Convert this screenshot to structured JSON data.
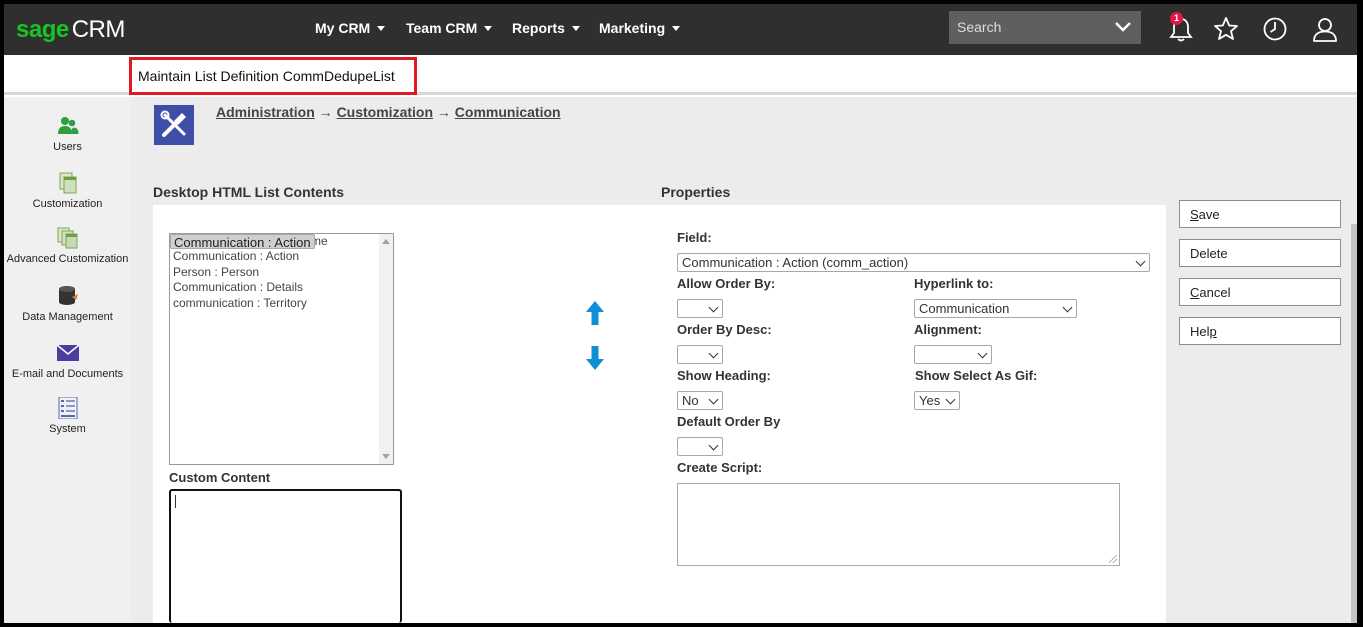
{
  "app": {
    "logo_brand": "sage",
    "logo_product": "CRM"
  },
  "nav": [
    {
      "label": "My CRM"
    },
    {
      "label": "Team CRM"
    },
    {
      "label": "Reports"
    },
    {
      "label": "Marketing"
    }
  ],
  "search": {
    "placeholder": "Search"
  },
  "notifications": {
    "count": "1"
  },
  "page_title": "Maintain List Definition CommDedupeList",
  "sidebar": {
    "items": [
      {
        "label": "Users",
        "icon": "users-icon"
      },
      {
        "label": "Customization",
        "icon": "customization-icon"
      },
      {
        "label": "Advanced Customization",
        "icon": "advanced-customization-icon"
      },
      {
        "label": "Data Management",
        "icon": "data-management-icon"
      },
      {
        "label": "E-mail and Documents",
        "icon": "email-icon"
      },
      {
        "label": "System",
        "icon": "system-icon"
      }
    ]
  },
  "breadcrumb": {
    "items": [
      "Administration",
      "Customization",
      "Communication"
    ],
    "separator": "→"
  },
  "list_section": {
    "title": "Desktop HTML List Contents",
    "items": [
      "Communication : Action",
      "Communication : Date / Time",
      "Communication : Action",
      "Person : Person",
      "Communication : Details",
      "communication : Territory"
    ],
    "selected_index": 0,
    "custom_content_label": "Custom Content"
  },
  "properties": {
    "title": "Properties",
    "field_label": "Field:",
    "field_value": "Communication : Action (comm_action)",
    "allow_order_by_label": "Allow Order By:",
    "allow_order_by_value": "",
    "hyperlink_label": "Hyperlink to:",
    "hyperlink_value": "Communication",
    "order_by_desc_label": "Order By Desc:",
    "order_by_desc_value": "",
    "alignment_label": "Alignment:",
    "alignment_value": "",
    "show_heading_label": "Show Heading:",
    "show_heading_value": "No",
    "show_select_gif_label": "Show Select As Gif:",
    "show_select_gif_value": "Yes",
    "default_order_by_label": "Default Order By",
    "default_order_by_value": "",
    "create_script_label": "Create Script:",
    "create_script_value": ""
  },
  "actions": {
    "save_first": "S",
    "save_rest": "ave",
    "delete": "Delete",
    "cancel_first": "C",
    "cancel_rest": "ancel",
    "help_first": "Hel",
    "help_u": "p"
  },
  "colors": {
    "brand_green": "#19c324",
    "topbar": "#2f2f2f",
    "highlight_red": "#e01a22",
    "arrow_blue": "#0f8fd6",
    "admin_icon_bg": "#3f4fa8"
  }
}
